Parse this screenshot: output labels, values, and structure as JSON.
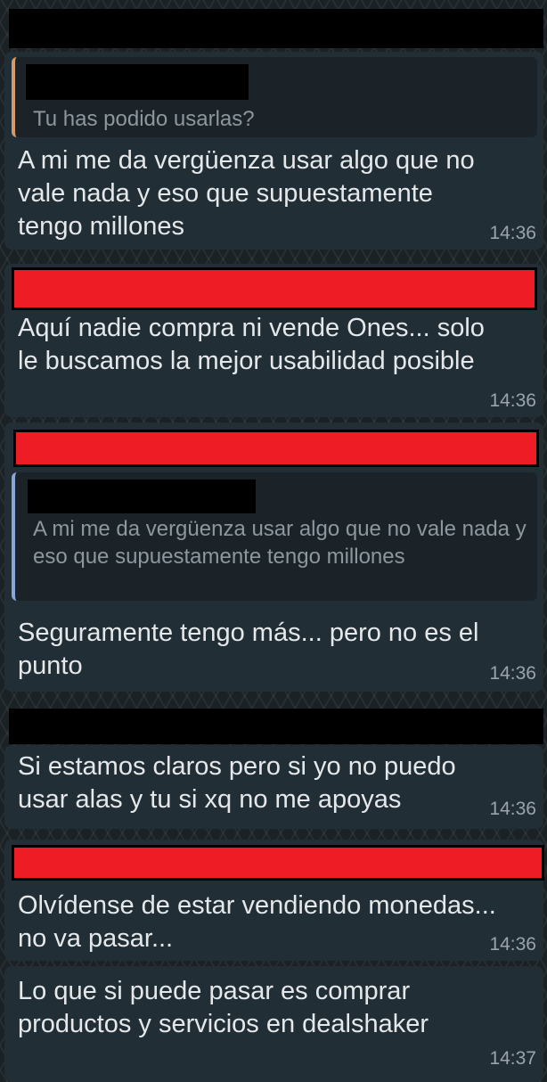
{
  "colors": {
    "bubble": "#222e35",
    "quote_bar_1": "#d59a6a",
    "quote_bar_2": "#8aa6d8",
    "redaction_red": "#ee1c24",
    "text": "#e4e8ea",
    "muted": "#8c979e"
  },
  "messages": [
    {
      "quote_text": "Tu has podido usarlas?",
      "text": "A mi me da vergüenza usar algo que no\nvale nada y eso que supuestamente\ntengo millones",
      "time": "14:36"
    },
    {
      "text": "Aquí nadie compra ni vende Ones... solo\nle buscamos la mejor usabilidad posible",
      "time": "14:36"
    },
    {
      "quote_text": "A mi me da vergüenza usar algo que no vale nada y eso que supuestamente tengo millones",
      "text": "Seguramente tengo más... pero no es el\npunto",
      "time": "14:36"
    },
    {
      "text": "Si estamos claros pero si yo no puedo\nusar alas y tu si xq no me apoyas",
      "time": "14:36"
    },
    {
      "text": "Olvídense de estar vendiendo monedas...\nno va pasar...",
      "time": "14:36"
    },
    {
      "text": "Lo que si puede pasar es comprar\nproductos y servicios en dealshaker",
      "time": "14:37"
    }
  ]
}
